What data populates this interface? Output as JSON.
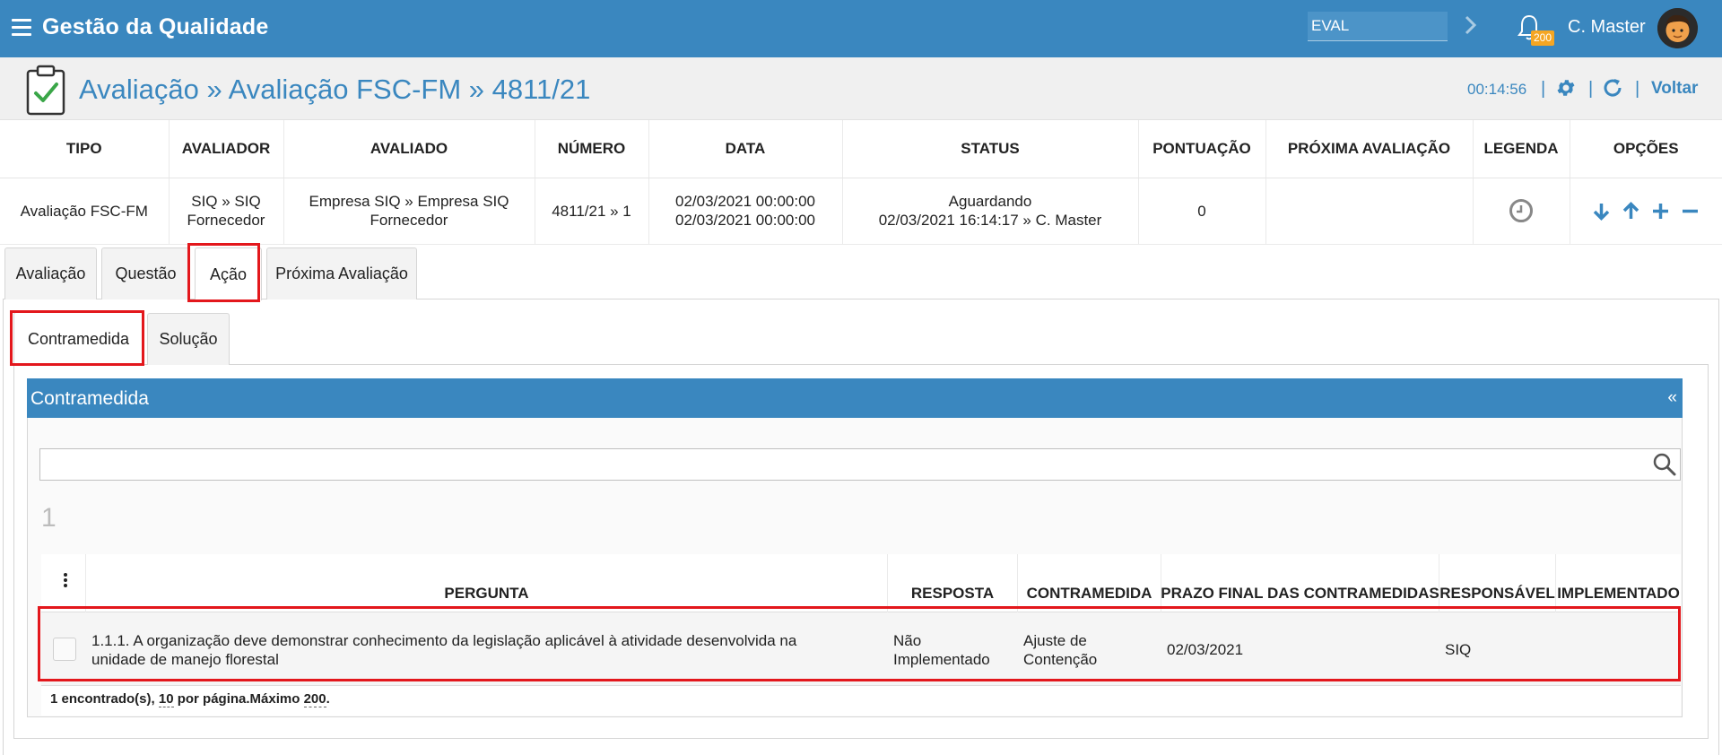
{
  "app": {
    "title": "Gestão da Qualidade"
  },
  "topbar": {
    "env_value": "EVAL",
    "notification_count": "200",
    "user_name": "C. Master"
  },
  "header": {
    "breadcrumb": "Avaliação » Avaliação FSC-FM » 4811/21",
    "timer": "00:14:56",
    "back_label": "Voltar",
    "separator": "|"
  },
  "summary": {
    "columns": [
      "TIPO",
      "AVALIADOR",
      "AVALIADO",
      "NÚMERO",
      "DATA",
      "STATUS",
      "PONTUAÇÃO",
      "PRÓXIMA AVALIAÇÃO",
      "LEGENDA",
      "OPÇÕES"
    ],
    "row": {
      "tipo": "Avaliação FSC-FM",
      "avaliador_1": "SIQ » SIQ",
      "avaliador_2": "Fornecedor",
      "avaliado_1": "Empresa SIQ » Empresa SIQ",
      "avaliado_2": "Fornecedor",
      "numero": "4811/21 » 1",
      "data_1": "02/03/2021 00:00:00",
      "data_2": "02/03/2021 00:00:00",
      "status_1": "Aguardando",
      "status_2": "02/03/2021 16:14:17 » C. Master",
      "pontuacao": "0",
      "proxima": ""
    }
  },
  "tabs": [
    {
      "label": "Avaliação"
    },
    {
      "label": "Questão"
    },
    {
      "label": "Ação"
    },
    {
      "label": "Próxima Avaliação"
    }
  ],
  "subtabs": [
    {
      "label": "Contramedida"
    },
    {
      "label": "Solução"
    }
  ],
  "panel": {
    "title": "Contramedida",
    "collapse": "«",
    "search_value": "",
    "page_number": "1"
  },
  "grid": {
    "columns": [
      "PERGUNTA",
      "RESPOSTA",
      "CONTRAMEDIDA",
      "PRAZO FINAL DAS CONTRAMEDIDAS",
      "RESPONSÁVEL",
      "IMPLEMENTADO"
    ],
    "rows": [
      {
        "pergunta_1": "1.1.1. A organização deve demonstrar conhecimento da legislação aplicável à atividade desenvolvida na",
        "pergunta_2": "unidade de manejo florestal",
        "resposta_1": "Não",
        "resposta_2": "Implementado",
        "contramedida_1": "Ajuste de",
        "contramedida_2": "Contenção",
        "prazo": "02/03/2021",
        "responsavel": "SIQ",
        "implementado": ""
      }
    ],
    "footer": {
      "found": "1 encontrado(s), ",
      "per_page": "10",
      "per_page_suffix": " por página.Máximo ",
      "max": "200",
      "end": "."
    }
  },
  "colors": {
    "primary": "#3a87bf",
    "highlight": "#e3171c",
    "badge": "#f5a623"
  }
}
